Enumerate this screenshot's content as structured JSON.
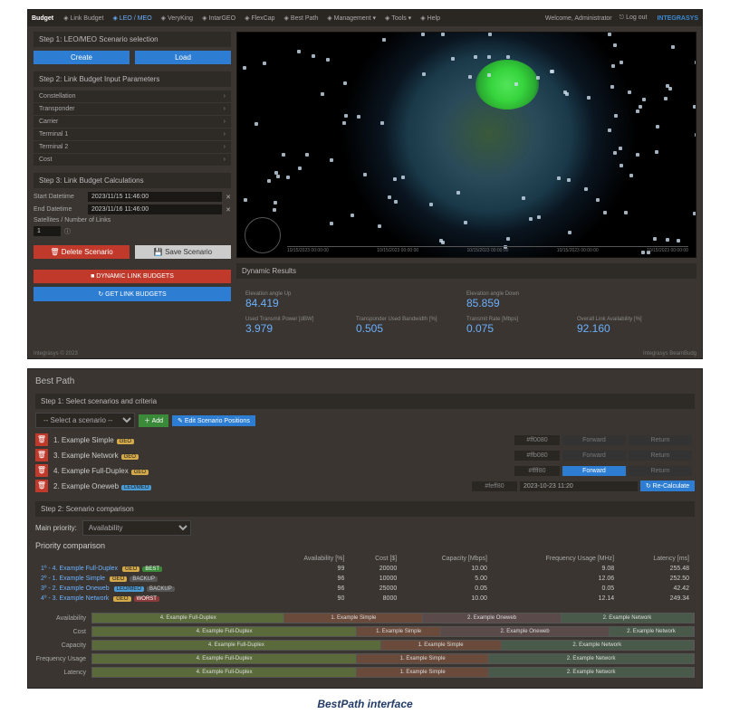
{
  "top": {
    "brand": "Budget",
    "nav": [
      "Link Budget",
      "LEO / MEO",
      "VeryKing",
      "IntarGEO",
      "FlexCap",
      "Best Path",
      "Management",
      "Tools",
      "Help"
    ],
    "welcome": "Welcome, Administrator",
    "logout": "Log out",
    "product": "INTEGRASYS",
    "step1": "Step 1: LEO/MEO Scenario selection",
    "create": "Create",
    "load": "Load",
    "step2": "Step 2: Link Budget Input Parameters",
    "accordion": [
      "Constellation",
      "Transponder",
      "Carrier",
      "Terminal 1",
      "Terminal 2",
      "Cost"
    ],
    "step3": "Step 3: Link Budget Calculations",
    "start_lbl": "Start Datetime",
    "start_val": "2023/11/15 11:46:00",
    "end_lbl": "End Datetime",
    "end_val": "2023/11/16 11:46:00",
    "sat_lbl": "Satellites / Number of Links",
    "sat_val": "1",
    "delete": "Delete Scenario",
    "save": "Save Scenario",
    "dynlb": "DYNAMIC LINK BUDGETS",
    "getlb": "GET LINK BUDGETS",
    "dyn_hdr": "Dynamic Results",
    "metrics": [
      {
        "l": "Elevation angle Up",
        "v": "84.419"
      },
      {
        "l": "Elevation angle Down",
        "v": "85.859"
      },
      {
        "l": "Used Transmit Power [dBW]",
        "v": "3.979"
      },
      {
        "l": "Transponder Used Bandwidth [%]",
        "v": "0.505"
      },
      {
        "l": "Transmit Rate [Mbps]",
        "v": "0.075"
      },
      {
        "l": "Overall Link Availability [%]",
        "v": "92.160"
      }
    ],
    "footer_l": "Integrasys © 2023",
    "footer_r": "Integrasys BeamBudg",
    "scale": [
      "10/15/2023 00:00:00",
      "10/15/2023 00:00:00",
      "10/15/2023 00:00:00",
      "10/15/2023 00:00:00",
      "10/15/2023 00:00:00"
    ]
  },
  "bp": {
    "title": "Best Path",
    "step1": "Step 1: Select scenarios and criteria",
    "select_ph": "-- Select a scenario --",
    "add": "Add",
    "edit": "Edit Scenario Positions",
    "rows": [
      {
        "n": "1. Example Simple",
        "badges": [
          "GEO"
        ],
        "hex": "#ff0080",
        "fwd": false
      },
      {
        "n": "3. Example Network",
        "badges": [
          "GEO"
        ],
        "hex": "#ffb080",
        "fwd": false
      },
      {
        "n": "4. Example Full-Duplex",
        "badges": [
          "GEO"
        ],
        "hex": "#ffff80",
        "fwd": true
      },
      {
        "n": "2. Example Oneweb",
        "badges": [
          "LEO/MEO"
        ],
        "hex": "#feff80",
        "fwd": false
      }
    ],
    "fwd": "Forward",
    "ret": "Return",
    "date": "2023-10-23 11:20",
    "recalc": "Re-Calculate",
    "step2": "Step 2: Scenario comparison",
    "main_prio_lbl": "Main priority:",
    "main_prio_val": "Availability",
    "prio_hdr": "Priority comparison",
    "cols": [
      "Availability [%]",
      "Cost [$]",
      "Capacity [Mbps]",
      "Frequency Usage [MHz]",
      "Latency [ms]"
    ],
    "table": [
      {
        "rank": "1º",
        "name": "4. Example Full-Duplex",
        "tags": [
          "GEO",
          "BEST"
        ],
        "v": [
          "99",
          "20000",
          "10.00",
          "9.08",
          "255.48"
        ]
      },
      {
        "rank": "2º",
        "name": "1. Example Simple",
        "tags": [
          "GEO",
          "BACKUP"
        ],
        "v": [
          "96",
          "10000",
          "5.00",
          "12.06",
          "252.50"
        ]
      },
      {
        "rank": "3º",
        "name": "2. Example Oneweb",
        "tags": [
          "LEO/MEO",
          "BACKUP"
        ],
        "v": [
          "96",
          "25000",
          "0.05",
          "0.05",
          "42.42"
        ]
      },
      {
        "rank": "4º",
        "name": "3. Example Network",
        "tags": [
          "GEO",
          "WORST"
        ],
        "v": [
          "90",
          "8000",
          "10.00",
          "12.14",
          "249.34"
        ]
      }
    ],
    "bar_labels": [
      "Availability",
      "Cost",
      "Capacity",
      "Frequency Usage",
      "Latency"
    ],
    "bars": [
      [
        {
          "t": "4. Example Full-Duplex",
          "w": 32,
          "c": 0
        },
        {
          "t": "1. Example Simple",
          "w": 23,
          "c": 1
        },
        {
          "t": "2. Example Oneweb",
          "w": 23,
          "c": 2
        },
        {
          "t": "2. Example Network",
          "w": 22,
          "c": 3
        }
      ],
      [
        {
          "t": "4. Example Full-Duplex",
          "w": 44,
          "c": 0
        },
        {
          "t": "1. Example Simple",
          "w": 14,
          "c": 1
        },
        {
          "t": "2. Example Oneweb",
          "w": 28,
          "c": 2
        },
        {
          "t": "2. Example Network",
          "w": 14,
          "c": 3
        }
      ],
      [
        {
          "t": "4. Example Full-Duplex",
          "w": 48,
          "c": 0
        },
        {
          "t": "1. Example Simple",
          "w": 20,
          "c": 1
        },
        {
          "t": "2. Example Network",
          "w": 32,
          "c": 3
        }
      ],
      [
        {
          "t": "4. Example Full-Duplex",
          "w": 44,
          "c": 0
        },
        {
          "t": "1. Example Simple",
          "w": 22,
          "c": 1
        },
        {
          "t": "2. Example Network",
          "w": 34,
          "c": 3
        }
      ],
      [
        {
          "t": "4. Example Full-Duplex",
          "w": 44,
          "c": 0
        },
        {
          "t": "1. Example Simple",
          "w": 22,
          "c": 1
        },
        {
          "t": "2. Example Network",
          "w": 34,
          "c": 3
        }
      ]
    ]
  },
  "caption": "BestPath interface"
}
